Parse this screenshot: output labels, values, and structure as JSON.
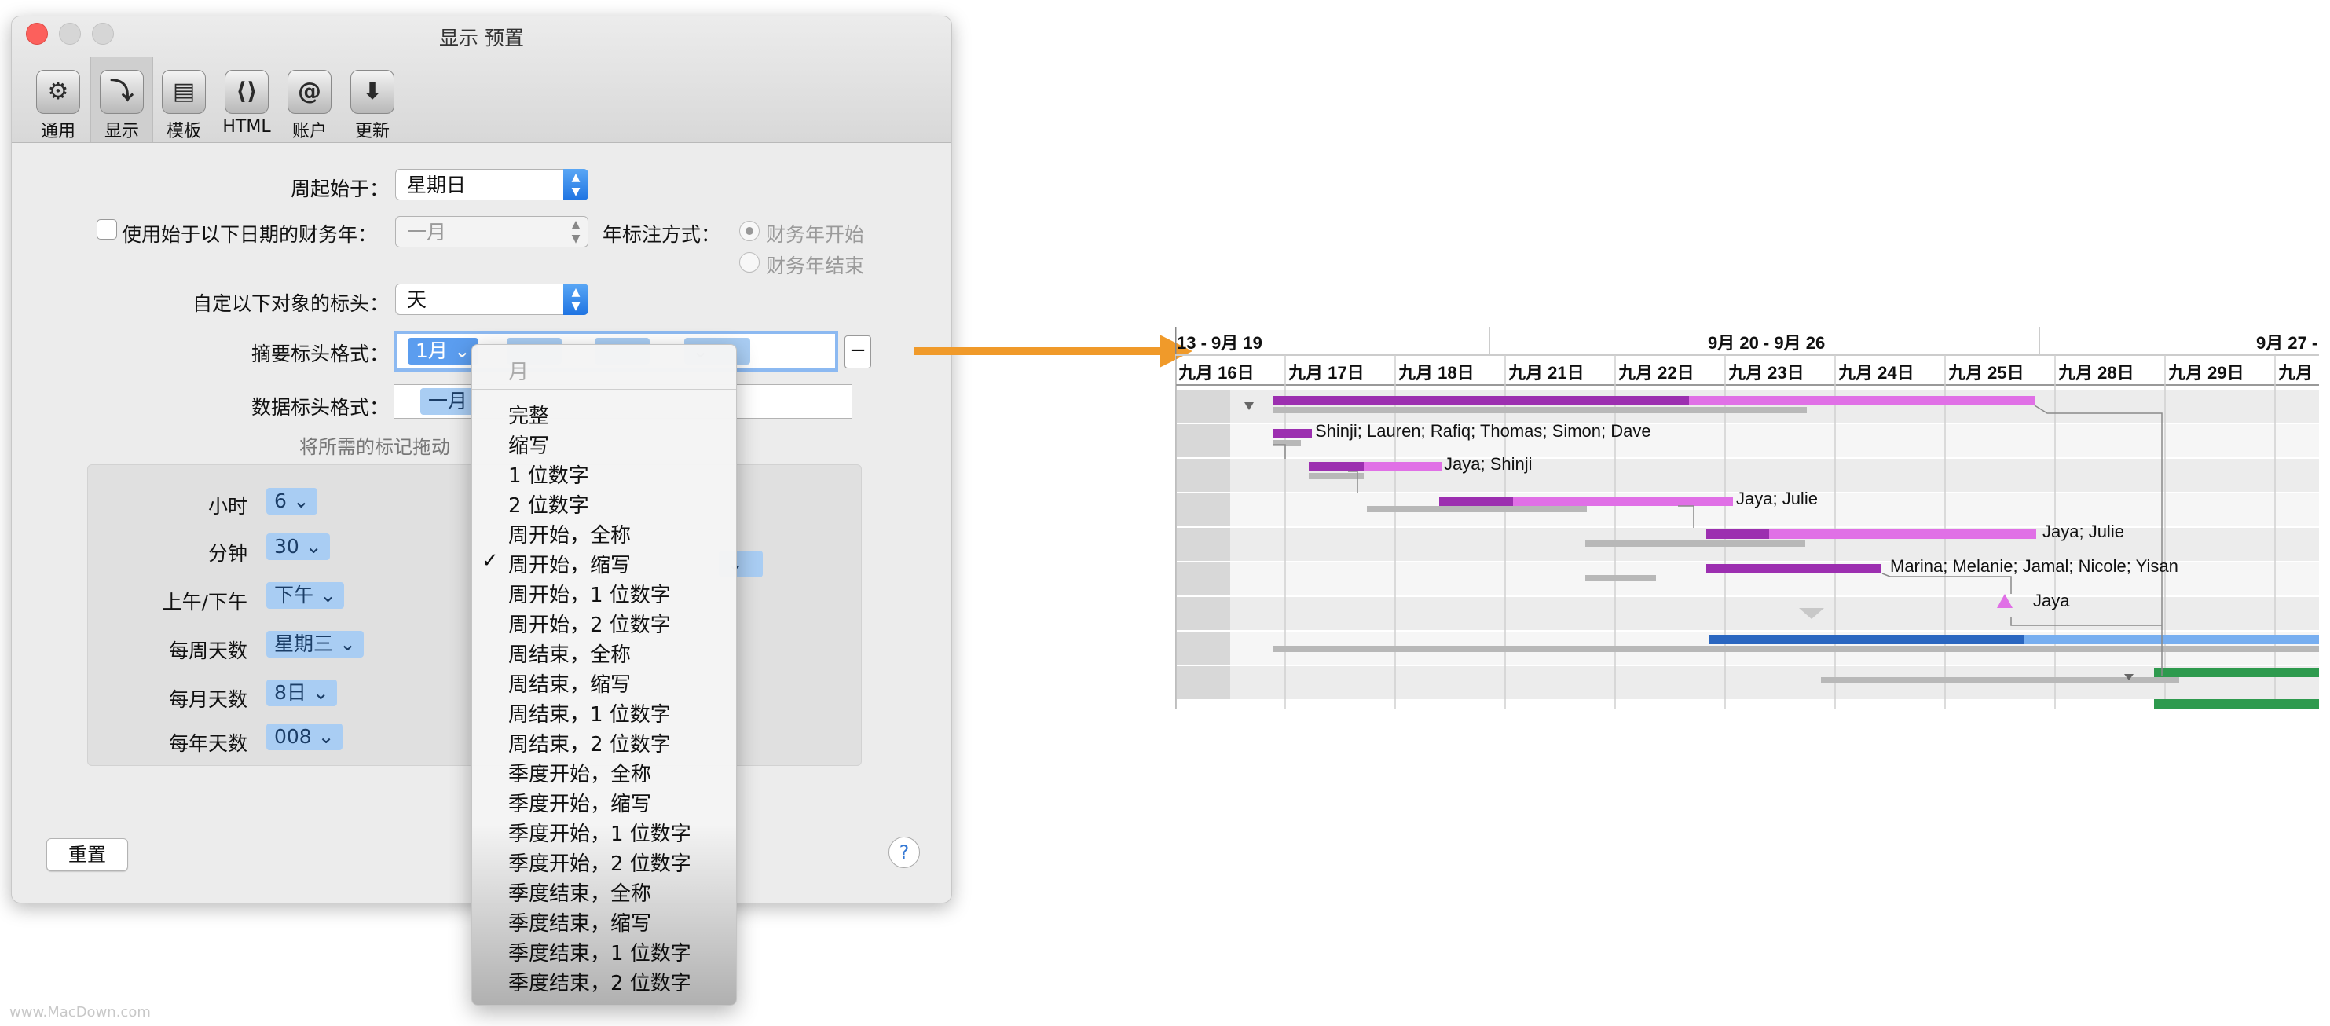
{
  "window": {
    "title": "显示 预置"
  },
  "toolbar": [
    {
      "label": "通用",
      "icon": "sliders-icon",
      "glyph": "⚙"
    },
    {
      "label": "显示",
      "icon": "steps-icon",
      "glyph": "⤵"
    },
    {
      "label": "模板",
      "icon": "template-icon",
      "glyph": "▤"
    },
    {
      "label": "HTML",
      "icon": "html-icon",
      "glyph": "⟨⟩"
    },
    {
      "label": "账户",
      "icon": "at-icon",
      "glyph": "@"
    },
    {
      "label": "更新",
      "icon": "download-icon",
      "glyph": "⬇"
    }
  ],
  "form": {
    "week_start_label": "周起始于：",
    "week_start_value": "星期日",
    "fiscal_label": "使用始于以下日期的财务年：",
    "fiscal_value": "一月",
    "year_note_label": "年标注方式：",
    "year_option1": "财务年开始",
    "year_option2": "财务年结束",
    "custom_header_label": "自定以下对象的标头：",
    "custom_header_value": "天",
    "summary_format_label": "摘要标头格式：",
    "summary_token_selected": "1月",
    "data_format_label": "数据标头格式：",
    "data_token": "一月",
    "drag_hint": "将所需的标记拖动",
    "minus": "−"
  },
  "tokens": {
    "rows": [
      {
        "label": "小时",
        "value": "6"
      },
      {
        "label": "分钟",
        "value": "30"
      },
      {
        "label": "上午/下午",
        "value": "下午"
      },
      {
        "label": "每周天数",
        "value": "星期三"
      },
      {
        "label": "每月天数",
        "value": "8日"
      },
      {
        "label": "每年天数",
        "value": "008"
      }
    ]
  },
  "footer": {
    "reset": "重置",
    "help": "?"
  },
  "menu": {
    "header": "月",
    "checked_index": 5,
    "items": [
      "完整",
      "缩写",
      "1 位数字",
      "2 位数字",
      "周开始，全称",
      "周开始，缩写",
      "周开始，1 位数字",
      "周开始，2 位数字",
      "周结束，全称",
      "周结束，缩写",
      "周结束，1 位数字",
      "周结束，2 位数字",
      "季度开始，全称",
      "季度开始，缩写",
      "季度开始，1 位数字",
      "季度开始，2 位数字",
      "季度结束，全称",
      "季度结束，缩写",
      "季度结束，1 位数字",
      "季度结束，2 位数字"
    ]
  },
  "gantt": {
    "weeks": [
      "13 - 9月 19",
      "9月 20 - 9月 26",
      "9月 27 -"
    ],
    "days": [
      "九月 16日",
      "九月 17日",
      "九月 18日",
      "九月 21日",
      "九月 22日",
      "九月 23日",
      "九月 24日",
      "九月 25日",
      "九月 28日",
      "九月 29日",
      "九月"
    ],
    "labels": [
      "Shinji; Lauren; Rafiq; Thomas; Simon; Dave",
      "Jaya; Shinji",
      "Jaya; Julie",
      "Jaya; Julie",
      "Marina; Melanie; Jamal; Nicole; Yisan",
      "Jaya"
    ],
    "colors": {
      "purple": "#9c2fb0",
      "pink": "#e070e6",
      "blue": "#2a66c0",
      "lightblue": "#77aef0",
      "green": "#2e9a4e",
      "gray": "#b8b8b8",
      "orange": "#f09a2a"
    }
  },
  "watermark": "www.MacDown.com"
}
